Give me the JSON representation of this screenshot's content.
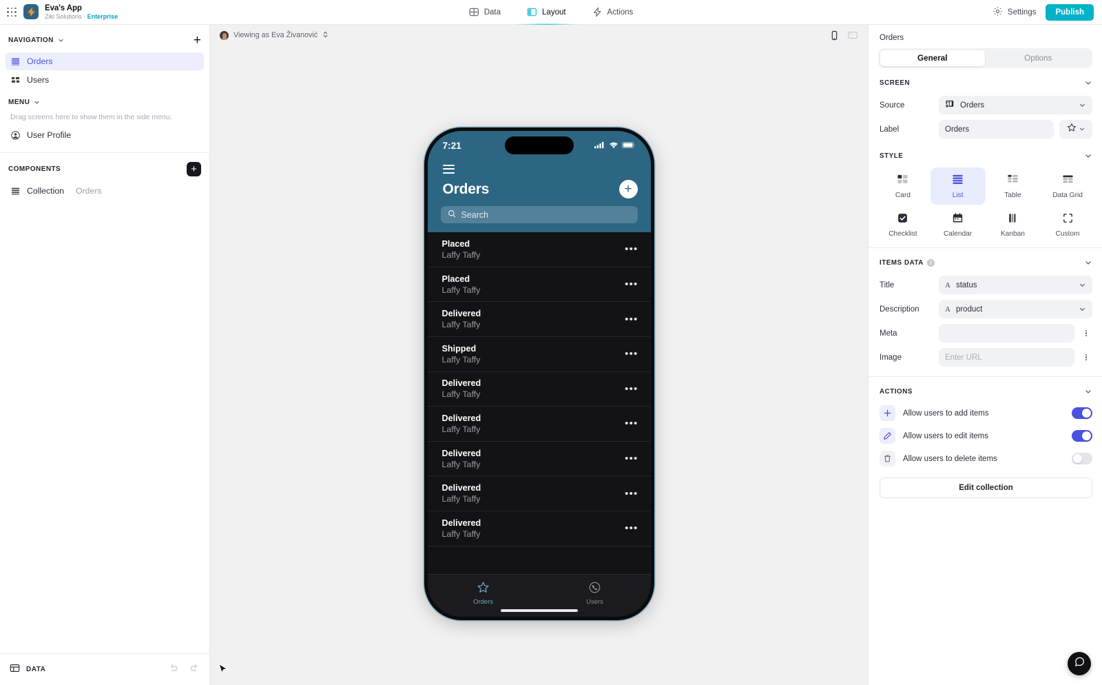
{
  "topbar": {
    "apps_icon": "grid-dots-icon",
    "logo_icon": "lightning-bolt-icon",
    "app_title": "Eva's App",
    "workspace": "Ziki Solutions",
    "workspace_sep": "·",
    "plan_badge": "Enterprise",
    "tabs": [
      {
        "label": "Data",
        "icon": "table-icon",
        "active": false
      },
      {
        "label": "Layout",
        "icon": "layout-panels-icon",
        "active": true
      },
      {
        "label": "Actions",
        "icon": "lightning-icon",
        "active": false
      }
    ],
    "settings_label": "Settings",
    "settings_icon": "gear-icon",
    "publish_label": "Publish"
  },
  "sidebar": {
    "navigation": {
      "title": "NAVIGATION",
      "add_icon": "plus-icon",
      "items": [
        {
          "label": "Orders",
          "icon": "list-icon",
          "active": true
        },
        {
          "label": "Users",
          "icon": "grid-squares-icon",
          "active": false
        }
      ]
    },
    "menu": {
      "title": "MENU",
      "hint": "Drag screens here to show them in the side menu.",
      "items": [
        {
          "label": "User Profile",
          "icon": "user-circle-icon"
        }
      ]
    },
    "components": {
      "title": "COMPONENTS",
      "add_icon": "plus-square-icon",
      "items": [
        {
          "label": "Collection",
          "sub": "Orders",
          "icon": "list-icon"
        }
      ]
    },
    "footer": {
      "data_label": "DATA",
      "data_icon": "table-icon",
      "undo_icon": "undo-arrow-icon",
      "redo_icon": "redo-arrow-icon"
    }
  },
  "canvas": {
    "viewing_as_prefix": "Viewing as",
    "viewing_as_user": "Eva Živanović",
    "viewing_as_full": "Viewing as Eva Živanović",
    "chevron_icon": "chevron-updown-icon",
    "device_phone_icon": "phone-device-icon",
    "device_tablet_icon": "tablet-device-icon",
    "cursor_icon": "mouse-cursor-icon",
    "help_icon": "chat-bubble-icon"
  },
  "phone": {
    "status": {
      "time": "7:21",
      "signal_icon": "cellular-signal-icon",
      "wifi_icon": "wifi-icon",
      "battery_icon": "battery-full-icon"
    },
    "menu_icon": "hamburger-menu-icon",
    "screen_title": "Orders",
    "add_icon": "plus-icon",
    "search_placeholder": "Search",
    "search_icon": "search-icon",
    "row_menu_icon": "ellipsis-icon",
    "items": [
      {
        "title": "Placed",
        "desc": "Laffy Taffy"
      },
      {
        "title": "Placed",
        "desc": "Laffy Taffy"
      },
      {
        "title": "Delivered",
        "desc": "Laffy Taffy"
      },
      {
        "title": "Shipped",
        "desc": "Laffy Taffy"
      },
      {
        "title": "Delivered",
        "desc": "Laffy Taffy"
      },
      {
        "title": "Delivered",
        "desc": "Laffy Taffy"
      },
      {
        "title": "Delivered",
        "desc": "Laffy Taffy"
      },
      {
        "title": "Delivered",
        "desc": "Laffy Taffy"
      },
      {
        "title": "Delivered",
        "desc": "Laffy Taffy"
      }
    ],
    "tabbar": [
      {
        "label": "Orders",
        "icon": "star-icon",
        "active": true
      },
      {
        "label": "Users",
        "icon": "phone-chat-icon",
        "active": false
      }
    ]
  },
  "rpanel": {
    "title": "Orders",
    "tabs": {
      "general": "General",
      "options": "Options",
      "active": "General"
    },
    "screen": {
      "title": "SCREEN",
      "source_label": "Source",
      "source_value": "Orders",
      "source_icon": "collection-source-icon",
      "label_label": "Label",
      "label_value": "Orders",
      "star_icon": "star-outline-icon",
      "chevron_icon": "chevron-down-icon"
    },
    "style": {
      "title": "STYLE",
      "options": [
        {
          "label": "Card",
          "icon": "card-grid-icon",
          "active": false
        },
        {
          "label": "List",
          "icon": "list-rows-icon",
          "active": true
        },
        {
          "label": "Table",
          "icon": "table-icon",
          "active": false
        },
        {
          "label": "Data Grid",
          "icon": "datagrid-icon",
          "active": false
        },
        {
          "label": "Checklist",
          "icon": "checkbox-icon",
          "active": false
        },
        {
          "label": "Calendar",
          "icon": "calendar-icon",
          "active": false
        },
        {
          "label": "Kanban",
          "icon": "kanban-icon",
          "active": false
        },
        {
          "label": "Custom",
          "icon": "custom-frame-icon",
          "active": false
        }
      ]
    },
    "items_data": {
      "title": "ITEMS DATA",
      "info_icon": "info-icon",
      "fields": [
        {
          "label": "Title",
          "type": "A",
          "value": "status",
          "placeholder": ""
        },
        {
          "label": "Description",
          "type": "A",
          "value": "product",
          "placeholder": ""
        },
        {
          "label": "Meta",
          "type": "",
          "value": "",
          "placeholder": ""
        },
        {
          "label": "Image",
          "type": "",
          "value": "",
          "placeholder": "Enter URL"
        }
      ]
    },
    "actions": {
      "title": "ACTIONS",
      "rows": [
        {
          "label": "Allow users to add items",
          "icon": "plus-icon",
          "on": true
        },
        {
          "label": "Allow users to edit items",
          "icon": "pencil-icon",
          "on": true
        },
        {
          "label": "Allow users to delete items",
          "icon": "trash-icon",
          "on": false
        }
      ],
      "edit_collection_label": "Edit collection"
    }
  },
  "colors": {
    "accent_publish": "#00b3c8",
    "accent_indigo": "#4b52e0",
    "phone_header": "#2d6683",
    "phone_bg": "#131315",
    "canvas_bg": "#f1f1f1"
  }
}
